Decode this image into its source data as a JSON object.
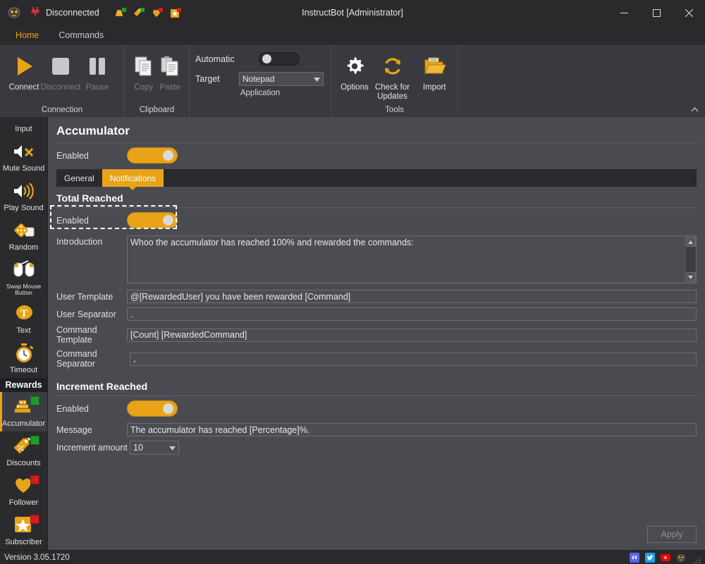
{
  "titlebar": {
    "app_icon": "instructbot-logo-icon",
    "connection_icon": "plug-disconnected-icon",
    "connection_status": "Disconnected",
    "quick_access": [
      {
        "name": "accumulator",
        "icon": "accumulator-icon",
        "badge": "#1f9d2b"
      },
      {
        "name": "discounts",
        "icon": "discount-tag-icon",
        "badge": "#1f9d2b"
      },
      {
        "name": "follower",
        "icon": "heart-icon",
        "badge": "#d01f1f"
      },
      {
        "name": "subscriber",
        "icon": "star-icon",
        "badge": "#d01f1f"
      }
    ],
    "title": "InstructBot [Administrator]",
    "minimize": "—",
    "maximize": "▫",
    "close": "✕"
  },
  "ribbon": {
    "tabs": [
      {
        "label": "Home",
        "active": true
      },
      {
        "label": "Commands",
        "active": false
      }
    ],
    "collapse_icon": "chevron-up-icon",
    "groups": [
      {
        "label": "Connection",
        "buttons": [
          {
            "label": "Connect",
            "icon": "play-icon",
            "disabled": false
          },
          {
            "label": "Disconnect",
            "icon": "stop-icon",
            "disabled": true
          },
          {
            "label": "Pause",
            "icon": "pause-icon",
            "disabled": true
          }
        ]
      },
      {
        "label": "Clipboard",
        "buttons": [
          {
            "label": "Copy",
            "icon": "copy-icon",
            "disabled": true
          },
          {
            "label": "Paste",
            "icon": "paste-icon",
            "disabled": true
          }
        ]
      },
      {
        "label": "Application",
        "automatic_label": "Automatic",
        "automatic_on": false,
        "target_label": "Target",
        "target_value": "Notepad",
        "target_options": [
          "Notepad"
        ]
      },
      {
        "label": "Tools",
        "buttons": [
          {
            "label": "Options",
            "icon": "gear-icon",
            "disabled": false
          },
          {
            "label": "Check for Updates",
            "icon": "refresh-icon",
            "disabled": false
          },
          {
            "label": "Import",
            "icon": "folder-open-icon",
            "disabled": false
          }
        ]
      }
    ]
  },
  "sidebar": {
    "items": [
      {
        "label": "Input",
        "icon": "input-icon",
        "selected": false,
        "clipped": true
      },
      {
        "label": "Mute Sound",
        "icon": "speaker-mute-icon",
        "selected": false
      },
      {
        "label": "Play Sound",
        "icon": "speaker-on-icon",
        "selected": false
      },
      {
        "label": "Random",
        "icon": "dice-icon",
        "selected": false
      },
      {
        "label": "Swap Mouse Button",
        "icon": "mouse-swap-icon",
        "selected": false,
        "small": true
      },
      {
        "label": "Text",
        "icon": "text-bubble-icon",
        "selected": false
      },
      {
        "label": "Timeout",
        "icon": "stopwatch-icon",
        "selected": false
      }
    ],
    "section_header": "Rewards",
    "rewards": [
      {
        "label": "Accumulator",
        "icon": "accumulator-icon",
        "badge": "#1f9d2b",
        "selected": true
      },
      {
        "label": "Discounts",
        "icon": "discount-tag-icon",
        "badge": "#1f9d2b",
        "selected": false
      },
      {
        "label": "Follower",
        "icon": "heart-icon",
        "badge": "#d01f1f",
        "selected": false
      },
      {
        "label": "Subscriber",
        "icon": "star-icon",
        "badge": "#d01f1f",
        "selected": false
      }
    ]
  },
  "main": {
    "page_title": "Accumulator",
    "enabled_label": "Enabled",
    "enabled_on": true,
    "tabs": [
      {
        "label": "General",
        "active": false
      },
      {
        "label": "Notifications",
        "active": true
      }
    ],
    "total_reached": {
      "section_title": "Total Reached",
      "enabled_label": "Enabled",
      "enabled_on": true,
      "introduction_label": "Introduction",
      "introduction_value": "Whoo the accumulator has reached 100% and rewarded the commands:",
      "user_template_label": "User Template",
      "user_template_value": "@[RewardedUser] you have been rewarded [Command]",
      "user_separator_label": "User Separator",
      "user_separator_value": ".",
      "command_template_label": "Command Template",
      "command_template_value": "[Count] [RewardedCommand]",
      "command_separator_label": "Command Separator",
      "command_separator_value": ","
    },
    "increment_reached": {
      "section_title": "Increment Reached",
      "enabled_label": "Enabled",
      "enabled_on": true,
      "message_label": "Message",
      "message_value": "The accumulator has reached [Percentage]%.",
      "increment_label": "Increment amount",
      "increment_value": "10",
      "increment_options": [
        "10"
      ]
    },
    "apply_label": "Apply"
  },
  "statusbar": {
    "version": "Version 3.05.1720",
    "icons": [
      {
        "name": "discord-icon",
        "color": "#5865f2"
      },
      {
        "name": "twitter-icon",
        "color": "#1da1f2"
      },
      {
        "name": "youtube-icon",
        "color": "#ff0000"
      },
      {
        "name": "instructbot-logo-icon",
        "color": "#e8a317"
      }
    ],
    "resize_grip": "resize-grip-icon"
  },
  "colors": {
    "accent": "#e8a317",
    "window_bg": "#2b2b2e",
    "content_bg": "#4a4b50",
    "ribbon_bg": "#393a3f"
  }
}
